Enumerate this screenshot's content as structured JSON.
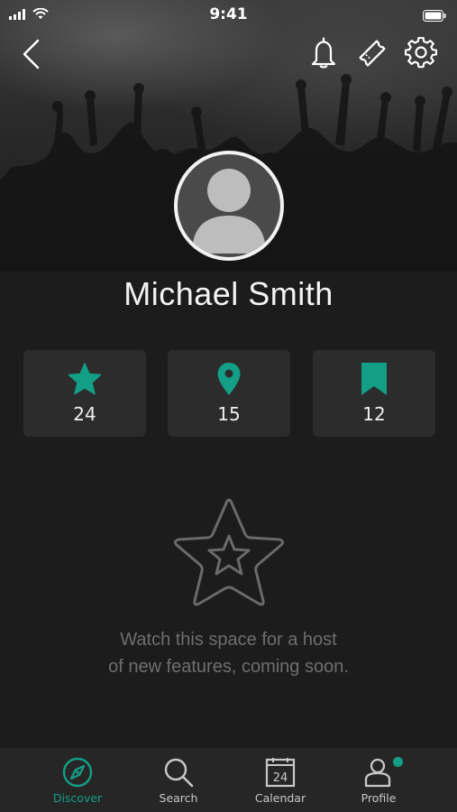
{
  "status_bar": {
    "time": "9:41"
  },
  "profile": {
    "name": "Michael Smith"
  },
  "stats": [
    {
      "icon": "star-icon",
      "value": "24"
    },
    {
      "icon": "map-pin-icon",
      "value": "15"
    },
    {
      "icon": "bookmark-icon",
      "value": "12"
    }
  ],
  "empty_state": {
    "line1": "Watch this space for a host",
    "line2": "of new features, coming soon."
  },
  "tabs": [
    {
      "label": "Discover",
      "icon": "compass-icon",
      "active": true
    },
    {
      "label": "Search",
      "icon": "search-icon",
      "active": false
    },
    {
      "label": "Calendar",
      "icon": "calendar-icon",
      "active": false,
      "calendar_day": "24"
    },
    {
      "label": "Profile",
      "icon": "user-icon",
      "active": false,
      "badge": true
    }
  ],
  "colors": {
    "accent": "#139f85",
    "background": "#1c1c1c",
    "card": "#2c2c2c",
    "tabbar": "#262626"
  }
}
